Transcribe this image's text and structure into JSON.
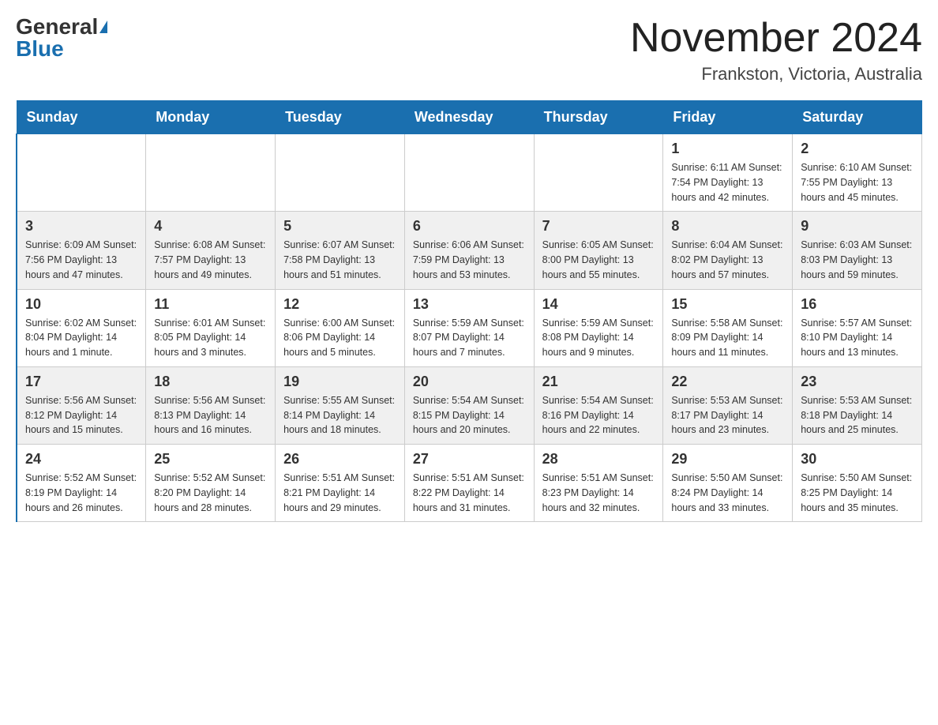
{
  "header": {
    "logo_general": "General",
    "logo_blue": "Blue",
    "month_year": "November 2024",
    "location": "Frankston, Victoria, Australia"
  },
  "days_of_week": [
    "Sunday",
    "Monday",
    "Tuesday",
    "Wednesday",
    "Thursday",
    "Friday",
    "Saturday"
  ],
  "weeks": [
    [
      {
        "day": "",
        "info": ""
      },
      {
        "day": "",
        "info": ""
      },
      {
        "day": "",
        "info": ""
      },
      {
        "day": "",
        "info": ""
      },
      {
        "day": "",
        "info": ""
      },
      {
        "day": "1",
        "info": "Sunrise: 6:11 AM\nSunset: 7:54 PM\nDaylight: 13 hours and 42 minutes."
      },
      {
        "day": "2",
        "info": "Sunrise: 6:10 AM\nSunset: 7:55 PM\nDaylight: 13 hours and 45 minutes."
      }
    ],
    [
      {
        "day": "3",
        "info": "Sunrise: 6:09 AM\nSunset: 7:56 PM\nDaylight: 13 hours and 47 minutes."
      },
      {
        "day": "4",
        "info": "Sunrise: 6:08 AM\nSunset: 7:57 PM\nDaylight: 13 hours and 49 minutes."
      },
      {
        "day": "5",
        "info": "Sunrise: 6:07 AM\nSunset: 7:58 PM\nDaylight: 13 hours and 51 minutes."
      },
      {
        "day": "6",
        "info": "Sunrise: 6:06 AM\nSunset: 7:59 PM\nDaylight: 13 hours and 53 minutes."
      },
      {
        "day": "7",
        "info": "Sunrise: 6:05 AM\nSunset: 8:00 PM\nDaylight: 13 hours and 55 minutes."
      },
      {
        "day": "8",
        "info": "Sunrise: 6:04 AM\nSunset: 8:02 PM\nDaylight: 13 hours and 57 minutes."
      },
      {
        "day": "9",
        "info": "Sunrise: 6:03 AM\nSunset: 8:03 PM\nDaylight: 13 hours and 59 minutes."
      }
    ],
    [
      {
        "day": "10",
        "info": "Sunrise: 6:02 AM\nSunset: 8:04 PM\nDaylight: 14 hours and 1 minute."
      },
      {
        "day": "11",
        "info": "Sunrise: 6:01 AM\nSunset: 8:05 PM\nDaylight: 14 hours and 3 minutes."
      },
      {
        "day": "12",
        "info": "Sunrise: 6:00 AM\nSunset: 8:06 PM\nDaylight: 14 hours and 5 minutes."
      },
      {
        "day": "13",
        "info": "Sunrise: 5:59 AM\nSunset: 8:07 PM\nDaylight: 14 hours and 7 minutes."
      },
      {
        "day": "14",
        "info": "Sunrise: 5:59 AM\nSunset: 8:08 PM\nDaylight: 14 hours and 9 minutes."
      },
      {
        "day": "15",
        "info": "Sunrise: 5:58 AM\nSunset: 8:09 PM\nDaylight: 14 hours and 11 minutes."
      },
      {
        "day": "16",
        "info": "Sunrise: 5:57 AM\nSunset: 8:10 PM\nDaylight: 14 hours and 13 minutes."
      }
    ],
    [
      {
        "day": "17",
        "info": "Sunrise: 5:56 AM\nSunset: 8:12 PM\nDaylight: 14 hours and 15 minutes."
      },
      {
        "day": "18",
        "info": "Sunrise: 5:56 AM\nSunset: 8:13 PM\nDaylight: 14 hours and 16 minutes."
      },
      {
        "day": "19",
        "info": "Sunrise: 5:55 AM\nSunset: 8:14 PM\nDaylight: 14 hours and 18 minutes."
      },
      {
        "day": "20",
        "info": "Sunrise: 5:54 AM\nSunset: 8:15 PM\nDaylight: 14 hours and 20 minutes."
      },
      {
        "day": "21",
        "info": "Sunrise: 5:54 AM\nSunset: 8:16 PM\nDaylight: 14 hours and 22 minutes."
      },
      {
        "day": "22",
        "info": "Sunrise: 5:53 AM\nSunset: 8:17 PM\nDaylight: 14 hours and 23 minutes."
      },
      {
        "day": "23",
        "info": "Sunrise: 5:53 AM\nSunset: 8:18 PM\nDaylight: 14 hours and 25 minutes."
      }
    ],
    [
      {
        "day": "24",
        "info": "Sunrise: 5:52 AM\nSunset: 8:19 PM\nDaylight: 14 hours and 26 minutes."
      },
      {
        "day": "25",
        "info": "Sunrise: 5:52 AM\nSunset: 8:20 PM\nDaylight: 14 hours and 28 minutes."
      },
      {
        "day": "26",
        "info": "Sunrise: 5:51 AM\nSunset: 8:21 PM\nDaylight: 14 hours and 29 minutes."
      },
      {
        "day": "27",
        "info": "Sunrise: 5:51 AM\nSunset: 8:22 PM\nDaylight: 14 hours and 31 minutes."
      },
      {
        "day": "28",
        "info": "Sunrise: 5:51 AM\nSunset: 8:23 PM\nDaylight: 14 hours and 32 minutes."
      },
      {
        "day": "29",
        "info": "Sunrise: 5:50 AM\nSunset: 8:24 PM\nDaylight: 14 hours and 33 minutes."
      },
      {
        "day": "30",
        "info": "Sunrise: 5:50 AM\nSunset: 8:25 PM\nDaylight: 14 hours and 35 minutes."
      }
    ]
  ]
}
